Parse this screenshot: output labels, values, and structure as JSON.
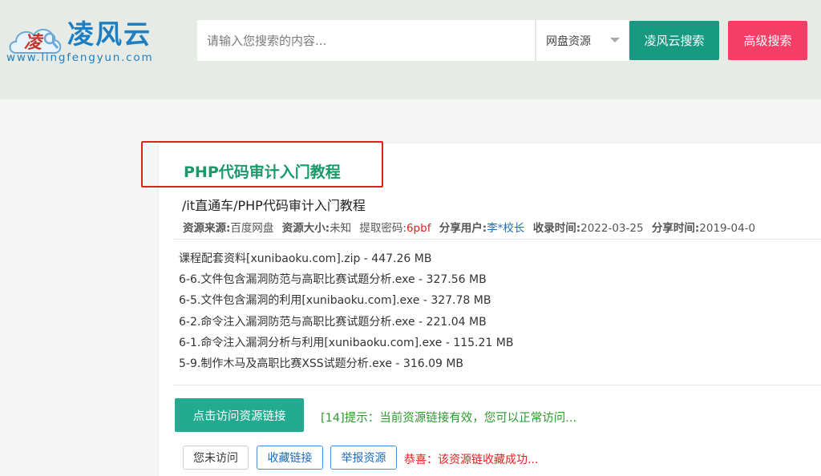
{
  "header": {
    "logo_char": "凌",
    "logo_text": "凌风云",
    "logo_url": "www.lingfengyun.com",
    "search_placeholder": "请输入您搜索的内容...",
    "select_value": "网盘资源",
    "search_button": "凌风云搜索",
    "advanced_button": "高级搜索"
  },
  "resource": {
    "title": "PHP代码审计入门教程",
    "path": "/it直通车/PHP代码审计入门教程",
    "meta": {
      "source_label": "资源来源:",
      "source_value": "百度网盘",
      "size_label": "资源大小:",
      "size_value": "未知",
      "pwd_label": "提取密码:",
      "pwd_value": "6pbf",
      "user_label": "分享用户:",
      "user_value": "李*校长",
      "collect_label": "收录时间:",
      "collect_value": "2022-03-25",
      "share_label": "分享时间:",
      "share_value": "2019-04-0"
    },
    "files": [
      "课程配套资料[xunibaoku.com].zip - 447.26 MB",
      "6-6.文件包含漏洞防范与高职比赛试题分析.exe - 327.56 MB",
      "6-5.文件包含漏洞的利用[xunibaoku.com].exe - 327.78 MB",
      "6-2.命令注入漏洞防范与高职比赛试题分析.exe - 221.04 MB",
      "6-1.命令注入漏洞分析与利用[xunibaoku.com].exe - 115.21 MB",
      "5-9.制作木马及高职比赛XSS试题分析.exe - 316.09 MB"
    ]
  },
  "actions": {
    "visit_button": "点击访问资源链接",
    "tip": "[14]提示：当前资源链接有效，您可以正常访问...",
    "not_visited": "您未访问",
    "favorite": "收藏链接",
    "report": "举报资源",
    "success": "恭喜：该资源链收藏成功..."
  },
  "colors": {
    "search_button": "#189a82",
    "advanced_button": "#f43e66",
    "title": "#189a6a",
    "highlight_border": "#e02020"
  }
}
